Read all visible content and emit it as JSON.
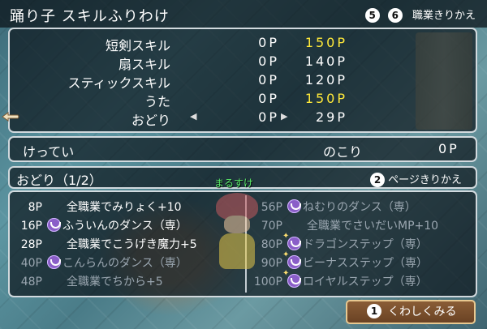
{
  "header": {
    "title": "踊り子 スキルふりわけ",
    "btn5": "5",
    "btn6": "6",
    "job_switch_label": "職業きりかえ"
  },
  "skills": [
    {
      "name": "短剣スキル",
      "points": "0P",
      "allocated": "150P",
      "highlight": true
    },
    {
      "name": "扇スキル",
      "points": "0P",
      "allocated": "140P",
      "highlight": false
    },
    {
      "name": "スティックスキル",
      "points": "0P",
      "allocated": "120P",
      "highlight": false
    },
    {
      "name": "うた",
      "points": "0P",
      "allocated": "150P",
      "highlight": true
    },
    {
      "name": "おどり",
      "points": "0P",
      "allocated": "29P",
      "highlight": false
    }
  ],
  "summary": {
    "confirm_label": "けってい",
    "remaining_label": "のこり",
    "remaining_value": "0P"
  },
  "character": {
    "name": "まるすけ"
  },
  "odori": {
    "title": "おどり（1/2）",
    "page_btn": "2",
    "page_label": "ページきりかえ",
    "left": [
      {
        "pt": "8P",
        "icon": "none",
        "label": "全職業でみりょく+10",
        "dim": false
      },
      {
        "pt": "16P",
        "icon": "dance-icon",
        "label": "ふういんのダンス（専）",
        "dim": false
      },
      {
        "pt": "28P",
        "icon": "none",
        "label": "全職業でこうげき魔力+5",
        "dim": false
      },
      {
        "pt": "40P",
        "icon": "dance-icon",
        "label": "こんらんのダンス（専）",
        "dim": true
      },
      {
        "pt": "48P",
        "icon": "none",
        "label": "全職業でちから+5",
        "dim": true
      }
    ],
    "right": [
      {
        "pt": "56P",
        "icon": "dance-icon",
        "label": "ねむりのダンス（専）",
        "dim": true
      },
      {
        "pt": "70P",
        "icon": "none",
        "label": "全職業でさいだいMP+10",
        "dim": true
      },
      {
        "pt": "80P",
        "icon": "special-dance-icon",
        "label": "ドラゴンステップ（専）",
        "dim": true
      },
      {
        "pt": "90P",
        "icon": "special-dance-icon",
        "label": "ビーナスステップ（専）",
        "dim": true
      },
      {
        "pt": "100P",
        "icon": "special-dance-icon",
        "label": "ロイヤルステップ（専）",
        "dim": true
      }
    ]
  },
  "footer": {
    "btn1": "1",
    "detail_label": "くわしくみる"
  },
  "colors": {
    "highlight": "#ffe93a",
    "name_tag": "#5df06c",
    "dim_text": "#9aa6b0"
  }
}
